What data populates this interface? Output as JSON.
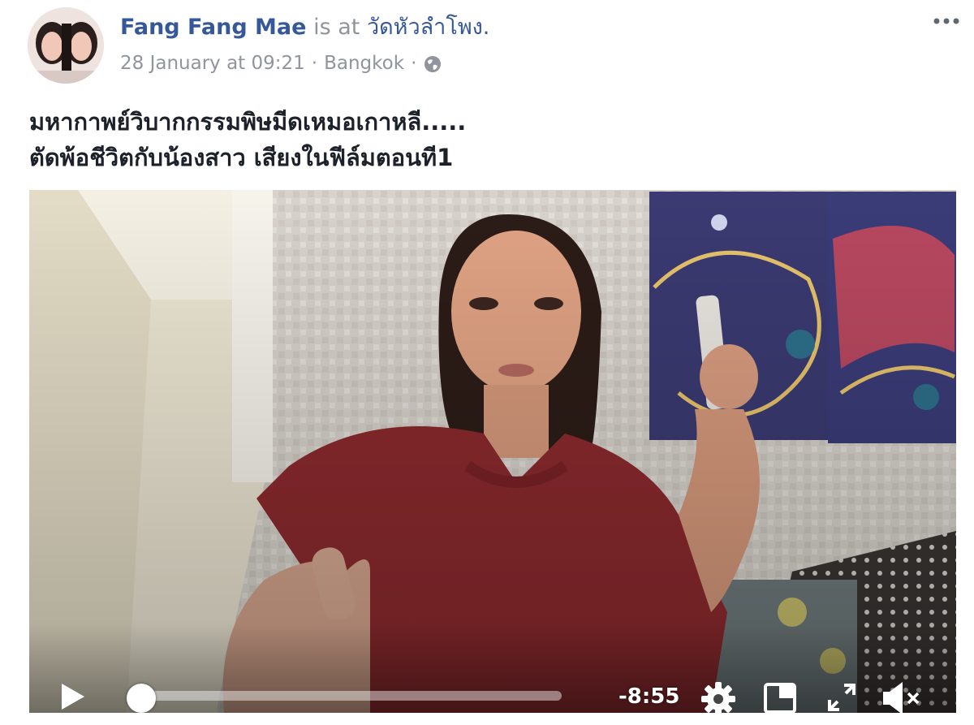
{
  "post": {
    "author_name": "Fang Fang Mae",
    "is_at": "is at",
    "place": "วัดหัวลำโพง.",
    "timestamp": "28 January at 09:21",
    "separator": "·",
    "location": "Bangkok",
    "separator2": "·",
    "privacy_icon": "globe-icon",
    "more_icon": "more-options-icon",
    "text_lines": [
      "มหากาพย์วิบากกรรมพิษมีดเหมอเกาหลี.....",
      "ตัดพ้อชีวิตกับน้องสาว เสียงในฟีล์มตอนที1"
    ]
  },
  "video": {
    "remaining_time": "-8:55",
    "progress": 0,
    "controls": {
      "play_icon": "play-icon",
      "settings_icon": "gear-icon",
      "pip_icon": "picture-in-picture-icon",
      "fullscreen_icon": "fullscreen-icon",
      "mute_icon": "muted-speaker-icon"
    }
  },
  "colors": {
    "link": "#365899",
    "meta": "#90949c",
    "text": "#1d2129",
    "shirt": "#8c2a2e"
  }
}
